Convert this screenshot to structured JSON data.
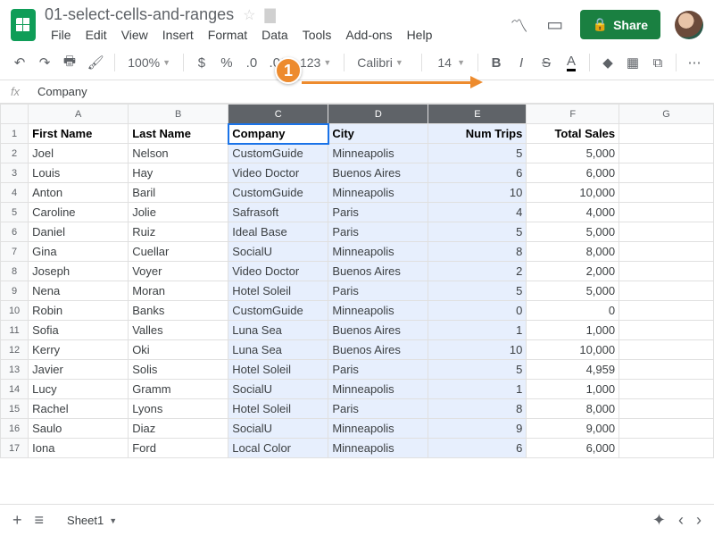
{
  "doc_title": "01-select-cells-and-ranges",
  "menus": [
    "File",
    "Edit",
    "View",
    "Insert",
    "Format",
    "Data",
    "Tools",
    "Add-ons",
    "Help"
  ],
  "share_label": "Share",
  "toolbar": {
    "zoom": "100%",
    "font": "Calibri",
    "font_size": "14"
  },
  "formula_bar_value": "Company",
  "columns": [
    "A",
    "B",
    "C",
    "D",
    "E",
    "F",
    "G"
  ],
  "selected_columns": [
    "C",
    "D",
    "E"
  ],
  "active_cell": "C1",
  "headers": [
    "First Name",
    "Last Name",
    "Company",
    "City",
    "Num Trips",
    "Total Sales"
  ],
  "rows": [
    [
      "Joel",
      "Nelson",
      "CustomGuide",
      "Minneapolis",
      "5",
      "5,000"
    ],
    [
      "Louis",
      "Hay",
      "Video Doctor",
      "Buenos Aires",
      "6",
      "6,000"
    ],
    [
      "Anton",
      "Baril",
      "CustomGuide",
      "Minneapolis",
      "10",
      "10,000"
    ],
    [
      "Caroline",
      "Jolie",
      "Safrasoft",
      "Paris",
      "4",
      "4,000"
    ],
    [
      "Daniel",
      "Ruiz",
      "Ideal Base",
      "Paris",
      "5",
      "5,000"
    ],
    [
      "Gina",
      "Cuellar",
      "SocialU",
      "Minneapolis",
      "8",
      "8,000"
    ],
    [
      "Joseph",
      "Voyer",
      "Video Doctor",
      "Buenos Aires",
      "2",
      "2,000"
    ],
    [
      "Nena",
      "Moran",
      "Hotel Soleil",
      "Paris",
      "5",
      "5,000"
    ],
    [
      "Robin",
      "Banks",
      "CustomGuide",
      "Minneapolis",
      "0",
      "0"
    ],
    [
      "Sofia",
      "Valles",
      "Luna Sea",
      "Buenos Aires",
      "1",
      "1,000"
    ],
    [
      "Kerry",
      "Oki",
      "Luna Sea",
      "Buenos Aires",
      "10",
      "10,000"
    ],
    [
      "Javier",
      "Solis",
      "Hotel Soleil",
      "Paris",
      "5",
      "4,959"
    ],
    [
      "Lucy",
      "Gramm",
      "SocialU",
      "Minneapolis",
      "1",
      "1,000"
    ],
    [
      "Rachel",
      "Lyons",
      "Hotel Soleil",
      "Paris",
      "8",
      "8,000"
    ],
    [
      "Saulo",
      "Diaz",
      "SocialU",
      "Minneapolis",
      "9",
      "9,000"
    ],
    [
      "Iona",
      "Ford",
      "Local Color",
      "Minneapolis",
      "6",
      "6,000"
    ]
  ],
  "sheet_name": "Sheet1",
  "annotation": {
    "badge": "1"
  }
}
